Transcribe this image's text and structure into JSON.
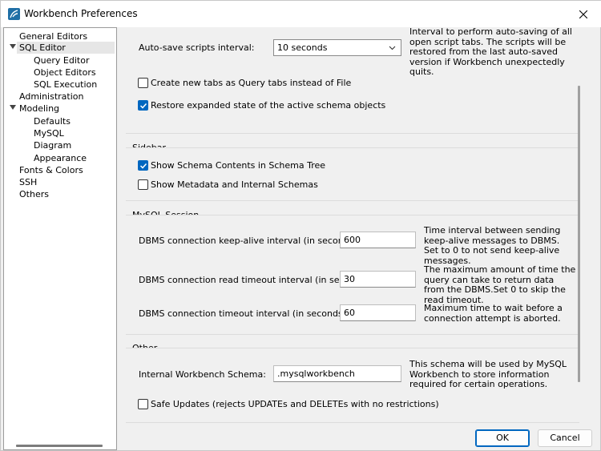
{
  "window": {
    "title": "Workbench Preferences"
  },
  "sidebar": {
    "items": [
      {
        "label": "General Editors"
      },
      {
        "label": "SQL Editor"
      },
      {
        "label": "Query Editor"
      },
      {
        "label": "Object Editors"
      },
      {
        "label": "SQL Execution"
      },
      {
        "label": "Administration"
      },
      {
        "label": "Modeling"
      },
      {
        "label": "Defaults"
      },
      {
        "label": "MySQL"
      },
      {
        "label": "Diagram"
      },
      {
        "label": "Appearance"
      },
      {
        "label": "Fonts & Colors"
      },
      {
        "label": "SSH"
      },
      {
        "label": "Others"
      }
    ],
    "selected": "SQL Editor"
  },
  "editor": {
    "autosave": {
      "label": "Auto-save scripts interval:",
      "value": "10 seconds",
      "help": "Interval to perform auto-saving of all open script tabs. The scripts will be restored from the last auto-saved version if Workbench unexpectedly quits."
    },
    "new_tabs_query": {
      "label": "Create new tabs as Query tabs instead of File",
      "checked": false
    },
    "restore_schema": {
      "label": "Restore expanded state of the active schema objects",
      "checked": true
    }
  },
  "sidebar_section": {
    "title": "Sidebar",
    "show_schema_contents": {
      "label": "Show Schema Contents in Schema Tree",
      "checked": true
    },
    "show_metadata": {
      "label": "Show Metadata and Internal Schemas",
      "checked": false
    }
  },
  "mysql_session": {
    "title": "MySQL Session",
    "keepalive": {
      "label": "DBMS connection keep-alive interval (in seconds):",
      "value": "600",
      "help": "Time interval between sending keep-alive messages to DBMS. Set to 0 to not send keep-alive messages."
    },
    "read_timeout": {
      "label": "DBMS connection read timeout interval (in seconds):",
      "value": "30",
      "help": "The maximum amount of time the query can take to return data from the DBMS.Set 0 to skip the read timeout."
    },
    "conn_timeout": {
      "label": "DBMS connection timeout interval (in seconds):",
      "value": "60",
      "help": "Maximum time to wait before a connection attempt is aborted."
    }
  },
  "other": {
    "title": "Other",
    "schema": {
      "label": "Internal Workbench Schema:",
      "value": ".mysqlworkbench",
      "help": "This schema will be used by MySQL Workbench to store information required for certain operations."
    },
    "safe_updates": {
      "label": "Safe Updates (rejects UPDATEs and DELETEs with no restrictions)",
      "checked": false
    }
  },
  "buttons": {
    "ok": "OK",
    "cancel": "Cancel"
  },
  "colors": {
    "accent": "#0067c0",
    "selection": "#e6e6e6"
  }
}
